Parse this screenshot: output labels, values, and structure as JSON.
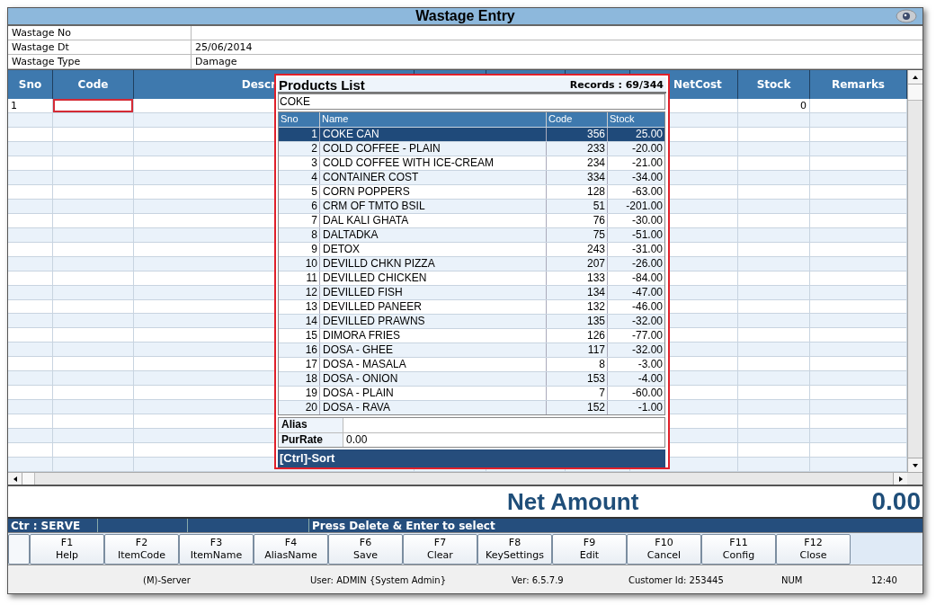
{
  "window": {
    "title": "Wastage Entry"
  },
  "fields": [
    {
      "label": "Wastage No"
    },
    {
      "label": "Wastage Dt",
      "value": "25/06/2014"
    },
    {
      "label": "Wastage Type",
      "value": "Damage"
    }
  ],
  "grid": {
    "columns": [
      "Sno",
      "Code",
      "Descr",
      "NetCost",
      "Stock",
      "Remarks"
    ],
    "rows": [
      {
        "sno": "1",
        "stock": "0",
        "code_focused": true
      }
    ]
  },
  "products_list": {
    "title": "Products List",
    "records": "Records : 69/344",
    "search": "COKE",
    "columns": [
      "Sno",
      "Name",
      "Code",
      "Stock"
    ],
    "rows": [
      {
        "sno": "1",
        "name": "COKE CAN",
        "code": "356",
        "stock": "25.00",
        "selected": true
      },
      {
        "sno": "2",
        "name": "COLD COFFEE - PLAIN",
        "code": "233",
        "stock": "-20.00",
        "selected": false
      },
      {
        "sno": "3",
        "name": "COLD COFFEE WITH ICE-CREAM",
        "code": "234",
        "stock": "-21.00",
        "selected": false
      },
      {
        "sno": "4",
        "name": "CONTAINER COST",
        "code": "334",
        "stock": "-34.00",
        "selected": false
      },
      {
        "sno": "5",
        "name": "CORN POPPERS",
        "code": "128",
        "stock": "-63.00",
        "selected": false
      },
      {
        "sno": "6",
        "name": "CRM OF TMTO BSIL",
        "code": "51",
        "stock": "-201.00",
        "selected": false
      },
      {
        "sno": "7",
        "name": "DAL KALI GHATA",
        "code": "76",
        "stock": "-30.00",
        "selected": false
      },
      {
        "sno": "8",
        "name": "DALTADKA",
        "code": "75",
        "stock": "-51.00",
        "selected": false
      },
      {
        "sno": "9",
        "name": "DETOX",
        "code": "243",
        "stock": "-31.00",
        "selected": false
      },
      {
        "sno": "10",
        "name": "DEVILLD CHKN PIZZA",
        "code": "207",
        "stock": "-26.00",
        "selected": false
      },
      {
        "sno": "11",
        "name": "DEVILLED CHICKEN",
        "code": "133",
        "stock": "-84.00",
        "selected": false
      },
      {
        "sno": "12",
        "name": "DEVILLED FISH",
        "code": "134",
        "stock": "-47.00",
        "selected": false
      },
      {
        "sno": "13",
        "name": "DEVILLED PANEER",
        "code": "132",
        "stock": "-46.00",
        "selected": false
      },
      {
        "sno": "14",
        "name": "DEVILLED PRAWNS",
        "code": "135",
        "stock": "-32.00",
        "selected": false
      },
      {
        "sno": "15",
        "name": "DIMORA FRIES",
        "code": "126",
        "stock": "-77.00",
        "selected": false
      },
      {
        "sno": "16",
        "name": "DOSA - GHEE",
        "code": "117",
        "stock": "-32.00",
        "selected": false
      },
      {
        "sno": "17",
        "name": "DOSA - MASALA",
        "code": "8",
        "stock": "-3.00",
        "selected": false
      },
      {
        "sno": "18",
        "name": "DOSA - ONION",
        "code": "153",
        "stock": "-4.00",
        "selected": false
      },
      {
        "sno": "19",
        "name": "DOSA - PLAIN",
        "code": "7",
        "stock": "-60.00",
        "selected": false
      },
      {
        "sno": "20",
        "name": "DOSA - RAVA",
        "code": "152",
        "stock": "-1.00",
        "selected": false
      }
    ],
    "details": [
      {
        "label": "Alias"
      },
      {
        "label": "PurRate",
        "value": "0.00"
      }
    ],
    "footer": "[Ctrl]-Sort"
  },
  "net_amount": {
    "label": "Net Amount",
    "value": "0.00"
  },
  "status_strip": [
    "Ctr : SERVE",
    "Press Delete & Enter to select"
  ],
  "function_keys": [
    {
      "key": "F1",
      "label": "Help"
    },
    {
      "key": "F2",
      "label": "ItemCode"
    },
    {
      "key": "F3",
      "label": "ItemName"
    },
    {
      "key": "F4",
      "label": "AliasName"
    },
    {
      "key": "F6",
      "label": "Save"
    },
    {
      "key": "F7",
      "label": "Clear"
    },
    {
      "key": "F8",
      "label": "KeySettings"
    },
    {
      "key": "F9",
      "label": "Edit"
    },
    {
      "key": "F10",
      "label": "Cancel"
    },
    {
      "key": "F11",
      "label": "Config"
    },
    {
      "key": "F12",
      "label": "Close"
    }
  ],
  "status_bar": [
    "(M)-Server",
    "User: ADMIN {System Admin}",
    "Ver: 6.5.7.9",
    "Customer Id: 253445",
    "NUM",
    "12:40"
  ]
}
